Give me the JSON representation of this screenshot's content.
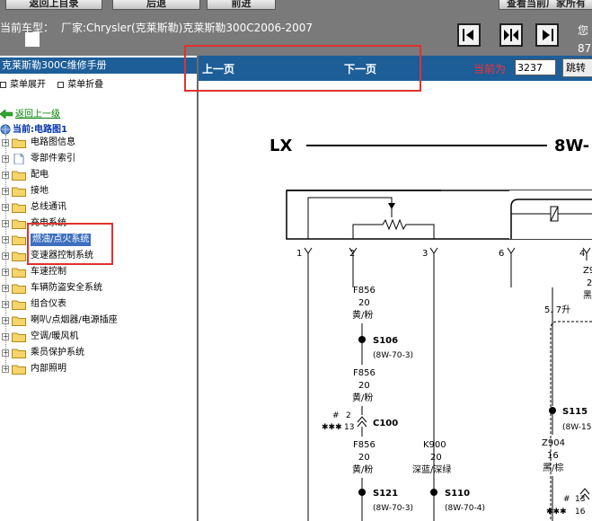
{
  "toolbar": {
    "btn_return": "返回上目录",
    "btn_back": "后退",
    "btn_forward": "前进",
    "btn_right": "查看当前厂家所有"
  },
  "info": {
    "label": "当前车型：",
    "text": "厂家:Chrysler(克莱斯勒)克莱斯勒300C2006-2007"
  },
  "corner_text": "您\n87",
  "nav_icons": [
    "nav-first-icon",
    "nav-fit-icon",
    "nav-last-icon"
  ],
  "sidebar": {
    "title": "克莱斯勒300C维修手册",
    "expand_label": "菜单展开",
    "collapse_label": "菜单折叠",
    "back_label": "返回上一级",
    "current_label": "当前:电路图1",
    "items": [
      {
        "label": "电路图信息",
        "icon": "folder-icon"
      },
      {
        "label": "零部件索引",
        "icon": "document-icon"
      },
      {
        "label": "配电",
        "icon": "folder-icon"
      },
      {
        "label": "接地",
        "icon": "folder-icon"
      },
      {
        "label": "总线通讯",
        "icon": "folder-icon"
      },
      {
        "label": "充电系统",
        "icon": "folder-icon"
      },
      {
        "label": "燃油/点火系统",
        "icon": "folder-icon",
        "selected": true
      },
      {
        "label": "变速器控制系统",
        "icon": "folder-icon"
      },
      {
        "label": "车速控制",
        "icon": "folder-icon"
      },
      {
        "label": "车辆防盗安全系统",
        "icon": "folder-icon"
      },
      {
        "label": "组合仪表",
        "icon": "folder-icon"
      },
      {
        "label": "喇叭/点烟器/电源插座",
        "icon": "folder-icon"
      },
      {
        "label": "空调/暖风机",
        "icon": "folder-icon"
      },
      {
        "label": "乘员保护系统",
        "icon": "folder-icon"
      },
      {
        "label": "内部照明",
        "icon": "folder-icon"
      }
    ]
  },
  "page_nav": {
    "prev": "上一页",
    "next": "下一页",
    "current_label": "当前为",
    "page_number": "3237",
    "jump": "跳转"
  },
  "diagram": {
    "header_left": "LX",
    "header_right": "8W-",
    "pin_labels": [
      "1",
      "2",
      "3",
      "6",
      "4"
    ],
    "wire_f856": "F856",
    "gauge_20": "20",
    "color_yellow_pink": "黄/粉",
    "splice_s106": "S106",
    "ref_s106": "(8W-70-3)",
    "hash": "#",
    "conn_n2": "2",
    "stars": "✱✱✱",
    "conn_n13": "13",
    "conn_c100": "C100",
    "wire_k900": "K900",
    "color_darkblue_darkgreen": "深蓝/深绿",
    "splice_s121": "S121",
    "ref_s121": "(8W-70-3)",
    "splice_s110": "S110",
    "ref_s110": "(8W-70-4)",
    "engine_57": "5. 7升",
    "splice_s115": "S115",
    "ref_s115": "(8W-15-",
    "wire_z904": "Z904",
    "gauge_16": "16",
    "color_black_brown": "黑/棕",
    "hash_13": "13",
    "stars_16": "16",
    "z9_partial": "Z9",
    "n20_partial": "2",
    "black_partial": "黑"
  }
}
